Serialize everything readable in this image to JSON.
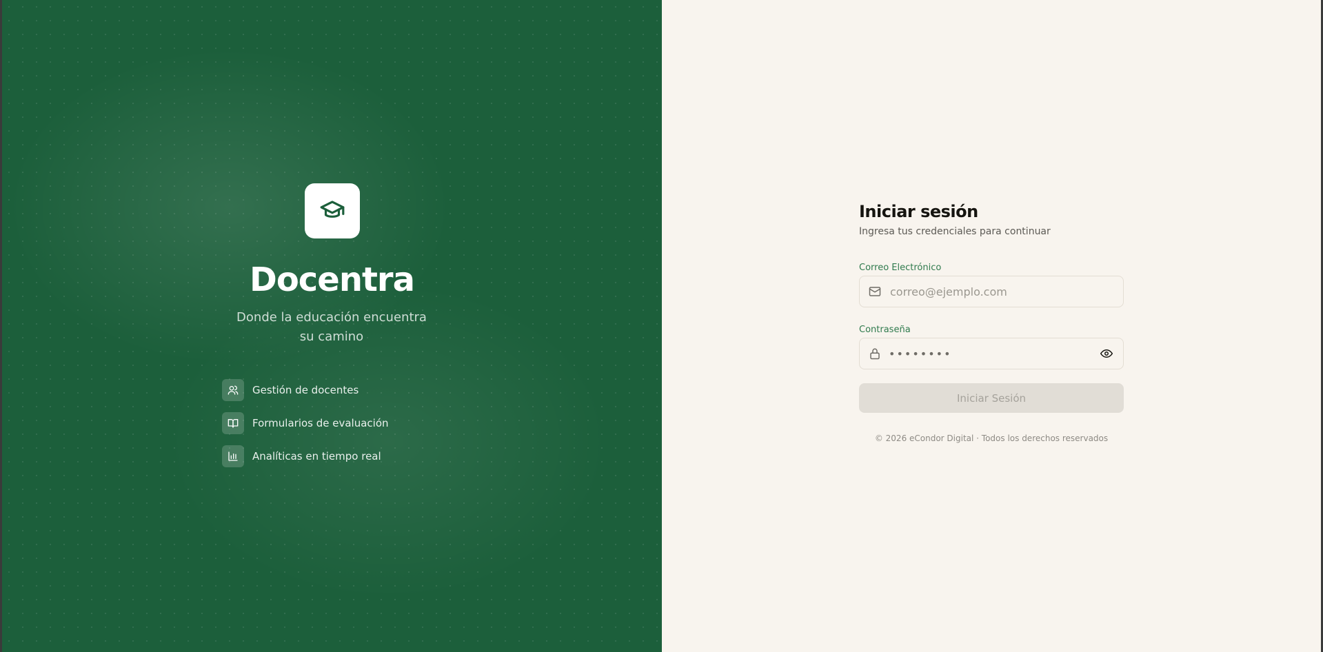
{
  "brand": {
    "name": "Docentra",
    "tagline": "Donde la educación encuentra su camino",
    "logo_icon": "graduation-cap-icon"
  },
  "features": [
    {
      "icon": "users-icon",
      "label": "Gestión de docentes"
    },
    {
      "icon": "book-open-icon",
      "label": "Formularios de evaluación"
    },
    {
      "icon": "bar-chart-icon",
      "label": "Analíticas en tiempo real"
    }
  ],
  "login": {
    "title": "Iniciar sesión",
    "subtitle": "Ingresa tus credenciales para continuar",
    "email_label": "Correo Electrónico",
    "email_placeholder": "correo@ejemplo.com",
    "email_value": "",
    "password_label": "Contraseña",
    "password_mask": "••••••••",
    "submit_label": "Iniciar Sesión"
  },
  "footer": {
    "copyright": "©  2026   eCondor Digital · Todos los derechos reservados"
  },
  "colors": {
    "panel_green": "#1c5f3b",
    "panel_cream": "#f8f4ee",
    "accent_green": "#2f7a4d"
  }
}
